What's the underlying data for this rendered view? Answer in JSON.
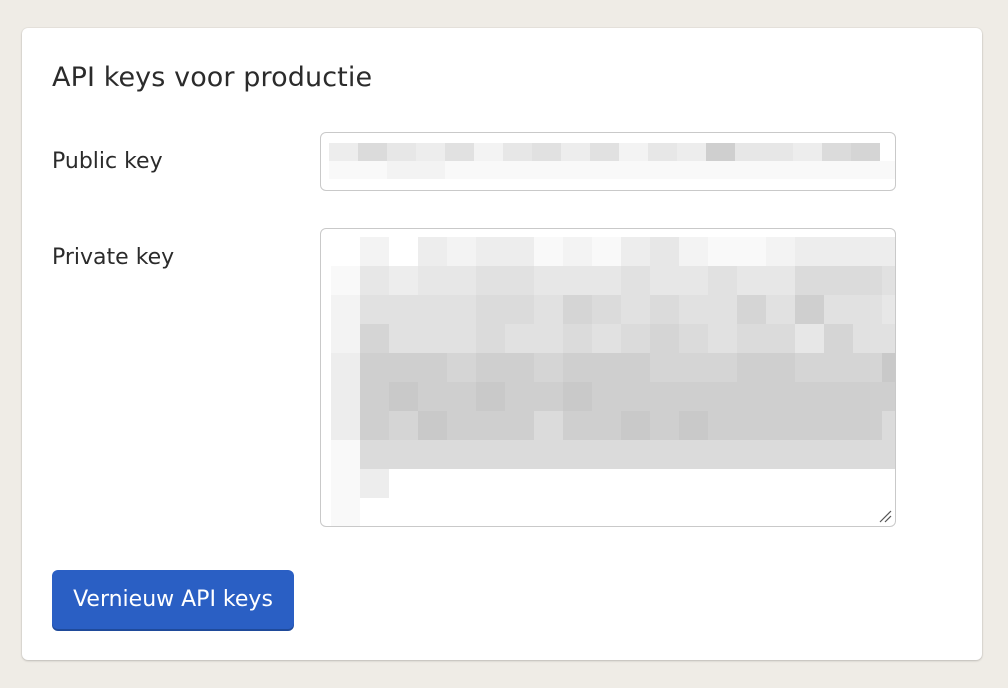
{
  "section": {
    "title": "API keys voor productie"
  },
  "fields": {
    "public_key": {
      "label": "Public key"
    },
    "private_key": {
      "label": "Private key"
    }
  },
  "actions": {
    "renew_label": "Vernieuw API keys"
  },
  "colors": {
    "page_background": "#efece6",
    "card_background": "#ffffff",
    "primary_button": "#2a5fc4",
    "field_border": "#c9c9c9"
  }
}
